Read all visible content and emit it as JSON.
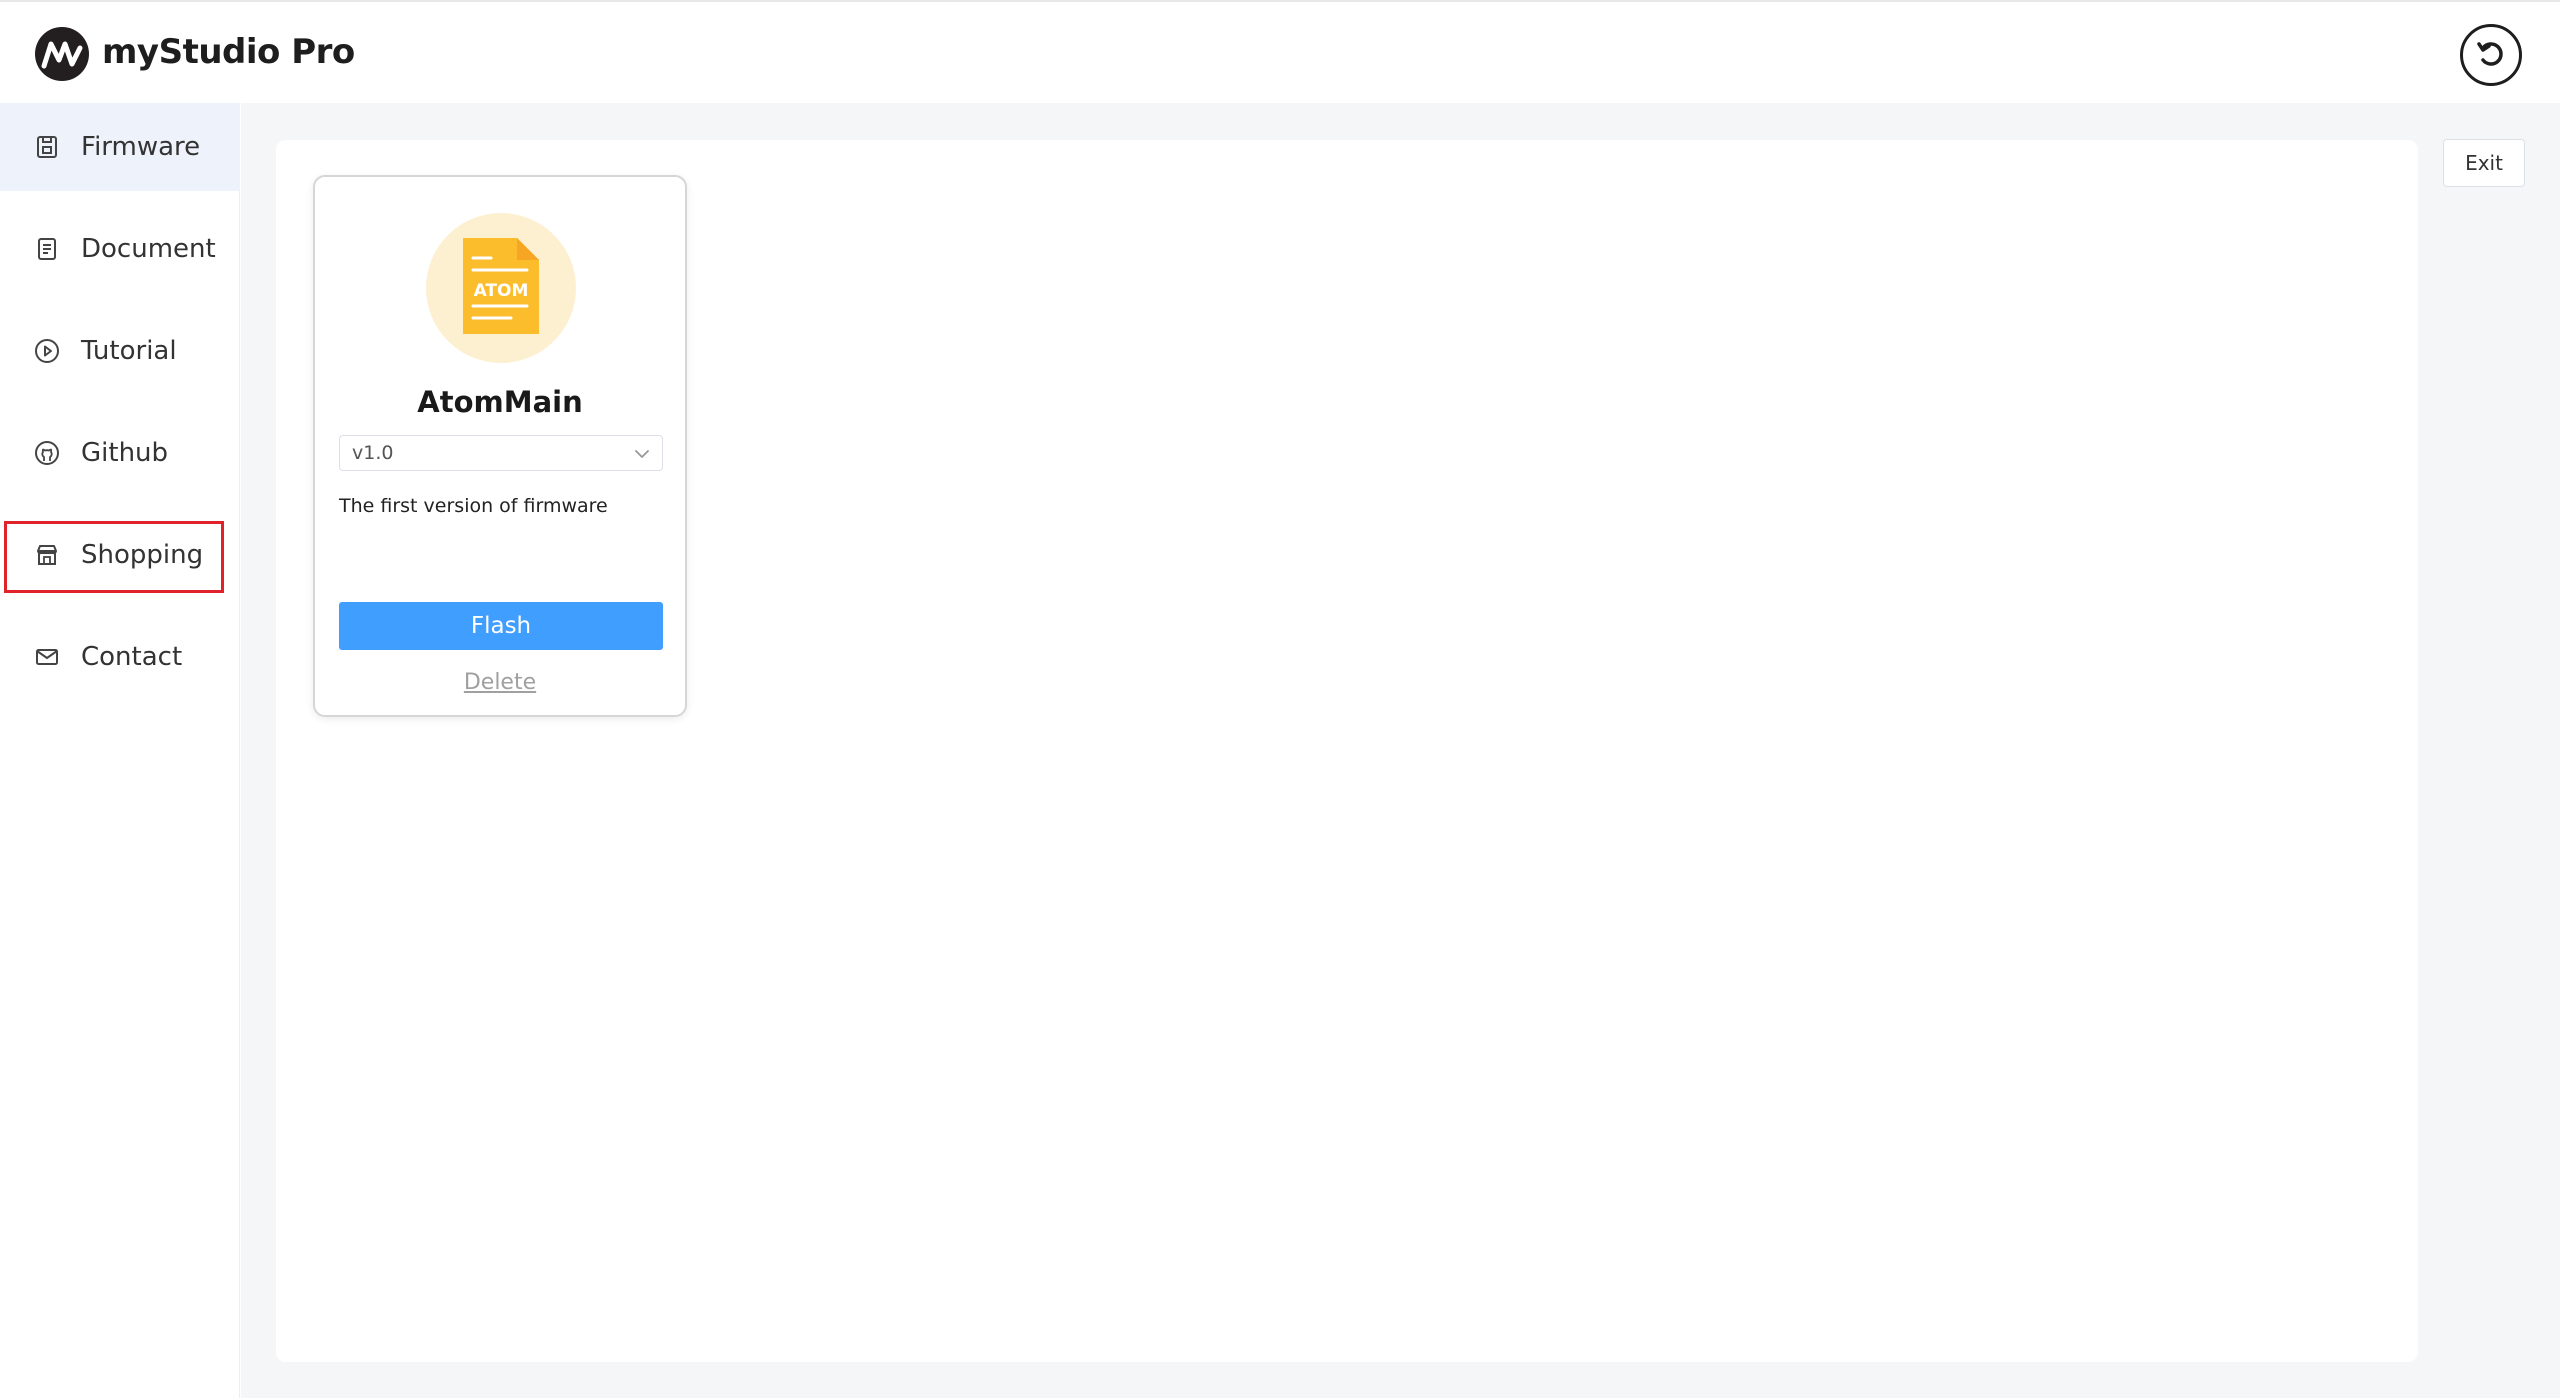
{
  "app": {
    "title": "myStudio Pro",
    "logo_icon": "mystudio-logo",
    "reset_icon": "undo-circle-icon"
  },
  "sidebar": {
    "items": [
      {
        "label": "Firmware",
        "icon": "firmware-icon",
        "active": true
      },
      {
        "label": "Document",
        "icon": "document-icon",
        "active": false
      },
      {
        "label": "Tutorial",
        "icon": "play-circle-icon",
        "active": false
      },
      {
        "label": "Github",
        "icon": "github-icon",
        "active": false,
        "highlighted": true
      },
      {
        "label": "Shopping",
        "icon": "shop-icon",
        "active": false
      },
      {
        "label": "Contact",
        "icon": "mail-icon",
        "active": false
      }
    ]
  },
  "toolbar": {
    "exit_label": "Exit"
  },
  "firmware_card": {
    "icon_text": "ATOM",
    "name": "AtomMain",
    "version_selected": "v1.0",
    "description": "The first version of firmware",
    "flash_label": "Flash",
    "delete_label": "Delete"
  },
  "colors": {
    "accent": "#409eff",
    "highlight_border": "#e0222b",
    "active_nav_bg": "#eef3fb",
    "file_icon": "#fbbd2c",
    "file_icon_bg": "#fdf0d0"
  }
}
